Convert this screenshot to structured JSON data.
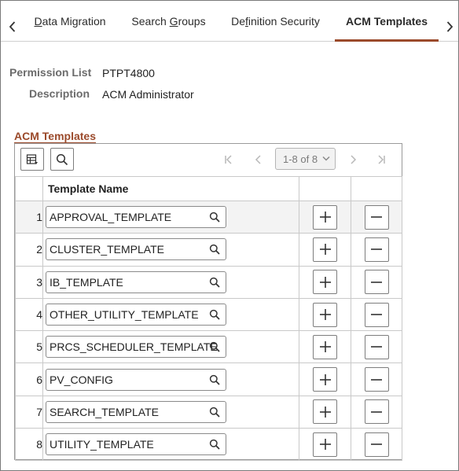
{
  "tabs": {
    "items": [
      {
        "label": "Data Migration",
        "underline_char": "D"
      },
      {
        "label": "Search Groups",
        "underline_char": "G"
      },
      {
        "label": "Definition Security",
        "underline_char": "f"
      },
      {
        "label": "ACM Templates",
        "active": true
      }
    ],
    "prev_icon": "chevron-left-icon",
    "next_icon": "chevron-right-icon"
  },
  "fields": {
    "permission_list_label": "Permission List",
    "permission_list_value": "PTPT4800",
    "description_label": "Description",
    "description_value": "ACM Administrator"
  },
  "grid": {
    "title": "ACM Templates",
    "pager_text": "1-8 of 8",
    "column_header": "Template Name",
    "rows": [
      {
        "num": "1",
        "name": "APPROVAL_TEMPLATE"
      },
      {
        "num": "2",
        "name": "CLUSTER_TEMPLATE"
      },
      {
        "num": "3",
        "name": "IB_TEMPLATE"
      },
      {
        "num": "4",
        "name": "OTHER_UTILITY_TEMPLATE"
      },
      {
        "num": "5",
        "name": "PRCS_SCHEDULER_TEMPLATE"
      },
      {
        "num": "6",
        "name": "PV_CONFIG"
      },
      {
        "num": "7",
        "name": "SEARCH_TEMPLATE"
      },
      {
        "num": "8",
        "name": "UTILITY_TEMPLATE"
      }
    ]
  },
  "colors": {
    "accent": "#9b4a2b",
    "label_gray": "#6b6b6b",
    "row_highlight": "#f3f3f3"
  }
}
